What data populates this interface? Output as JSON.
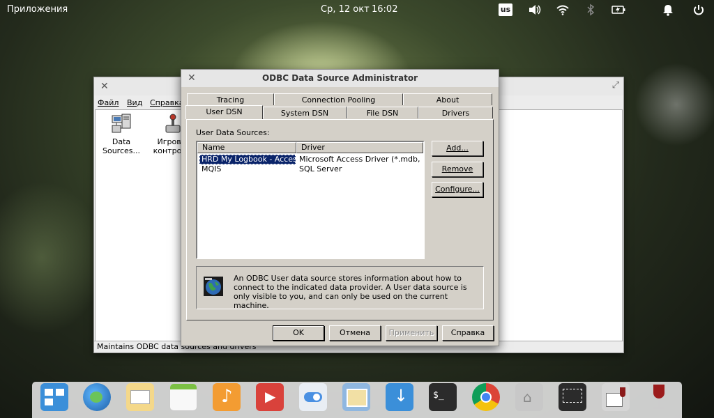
{
  "top_panel": {
    "applications": "Приложения",
    "date": "Ср, 12 окт",
    "time": "16:02",
    "keyboard_layout": "us",
    "tray_icons": [
      "volume-icon",
      "wifi-icon",
      "bluetooth-icon",
      "battery-icon",
      "notifications-icon",
      "power-icon"
    ]
  },
  "control_panel": {
    "menu": {
      "file": "Файл",
      "view": "Вид",
      "help": "Справка"
    },
    "items": [
      {
        "label_line1": "Data",
        "label_line2": "Sources..."
      },
      {
        "label_line1": "Игровы",
        "label_line2": "контролл"
      }
    ],
    "status": "Maintains ODBC data sources and drivers"
  },
  "dialog": {
    "title": "ODBC Data Source Administrator",
    "tabs_back": [
      "Tracing",
      "Connection Pooling",
      "About"
    ],
    "tabs_front": [
      "User DSN",
      "System DSN",
      "File DSN",
      "Drivers"
    ],
    "active_tab": "User DSN",
    "section_label": "User Data Sources:",
    "columns": [
      "Name",
      "Driver"
    ],
    "rows": [
      {
        "name": "HRD My Logbook - Access",
        "driver": "Microsoft Access Driver (*.mdb, ...",
        "selected": true
      },
      {
        "name": "MQIS",
        "driver": "SQL Server",
        "selected": false
      }
    ],
    "buttons": {
      "add": "Add...",
      "remove": "Remove",
      "configure": "Configure..."
    },
    "info": "An ODBC User data source stores information about how to connect to the indicated data provider.   A User data source is only visible to you, and can only be used on the current machine.",
    "footer": {
      "ok": "OK",
      "cancel": "Отмена",
      "apply": "Применить",
      "help": "Справка"
    }
  },
  "dock": [
    "multitasking-icon",
    "browser-globe-icon",
    "mail-icon",
    "calendar-icon",
    "music-icon",
    "videos-icon",
    "settings-toggle-icon",
    "photos-icon",
    "appcenter-download-icon",
    "terminal-icon",
    "chrome-icon",
    "files-home-icon",
    "screenshot-icon",
    "wine-control-icon",
    "wine-icon"
  ],
  "colors": {
    "selection": "#0a246a",
    "dialog_bg": "#d4d0c8"
  }
}
